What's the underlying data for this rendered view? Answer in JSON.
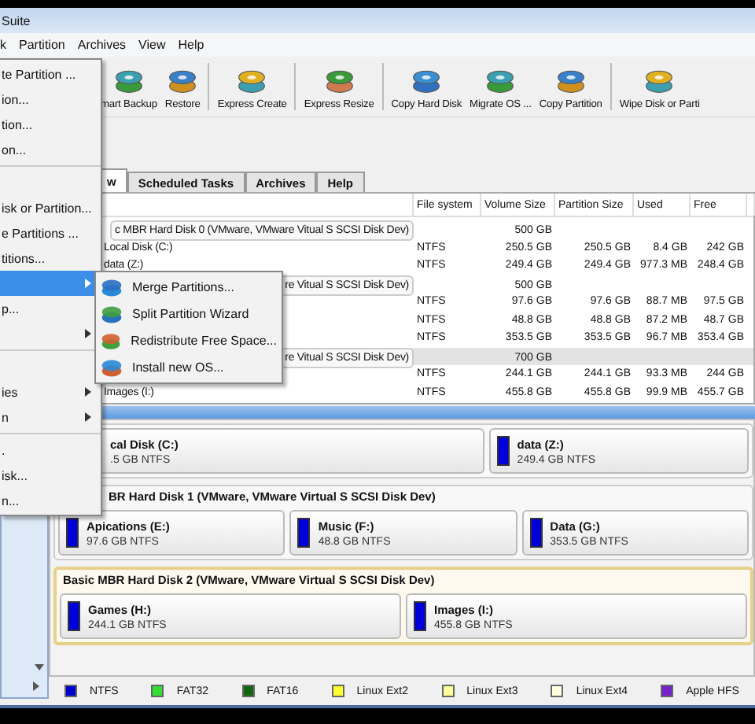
{
  "window": {
    "title": "Suite"
  },
  "menu_bar": [
    "k",
    "Partition",
    "Archives",
    "View",
    "Help"
  ],
  "toolbar": [
    {
      "kind": "button",
      "label": "mart Backup"
    },
    {
      "kind": "button",
      "label": "Restore"
    },
    {
      "kind": "separator"
    },
    {
      "kind": "button",
      "label": "Express Create"
    },
    {
      "kind": "separator"
    },
    {
      "kind": "button",
      "label": "Express Resize"
    },
    {
      "kind": "separator"
    },
    {
      "kind": "button",
      "label": "Copy Hard Disk"
    },
    {
      "kind": "button",
      "label": "Migrate OS ..."
    },
    {
      "kind": "button",
      "label": "Copy Partition"
    },
    {
      "kind": "separator"
    },
    {
      "kind": "button",
      "label": "Wipe Disk or Parti"
    }
  ],
  "tabs": [
    {
      "label": "w",
      "selected": true
    },
    {
      "label": "Scheduled Tasks",
      "selected": false
    },
    {
      "label": "Archives",
      "selected": false
    },
    {
      "label": "Help",
      "selected": false
    }
  ],
  "table": {
    "columns": [
      "File system",
      "Volume Size",
      "Partition Size",
      "Used",
      "Free"
    ],
    "rows": [
      {
        "kind": "disk",
        "name": "c MBR Hard Disk 0 (VMware, VMware Vitual S SCSI Disk Dev)",
        "volume_size": "500 GB",
        "selected": false
      },
      {
        "kind": "partition",
        "name": "Local Disk (C:)",
        "file_system": "NTFS",
        "volume_size": "250.5 GB",
        "partition_size": "250.5 GB",
        "used": "8.4 GB",
        "free": "242 GB"
      },
      {
        "kind": "partition",
        "name": "data (Z:)",
        "file_system": "NTFS",
        "volume_size": "249.4 GB",
        "partition_size": "249.4 GB",
        "used": "977.3 MB",
        "free": "248.4 GB"
      },
      {
        "kind": "disk",
        "name": "re Vitual S SCSI Disk Dev)",
        "volume_size": "500 GB",
        "selected": false
      },
      {
        "kind": "partition",
        "file_system": "NTFS",
        "volume_size": "97.6 GB",
        "partition_size": "97.6 GB",
        "used": "88.7 MB",
        "free": "97.5 GB"
      },
      {
        "kind": "partition",
        "file_system": "NTFS",
        "volume_size": "48.8 GB",
        "partition_size": "48.8 GB",
        "used": "87.2 MB",
        "free": "48.7 GB"
      },
      {
        "kind": "partition",
        "file_system": "NTFS",
        "volume_size": "353.5 GB",
        "partition_size": "353.5 GB",
        "used": "96.7 MB",
        "free": "353.4 GB"
      },
      {
        "kind": "disk",
        "name": "re Vitual S SCSI Disk Dev)",
        "volume_size": "700 GB",
        "selected": true
      },
      {
        "kind": "partition",
        "file_system": "NTFS",
        "volume_size": "244.1 GB",
        "partition_size": "244.1 GB",
        "used": "93.3 MB",
        "free": "244 GB"
      },
      {
        "kind": "partition",
        "name": "Images (I:)",
        "file_system": "NTFS",
        "volume_size": "455.8 GB",
        "partition_size": "455.8 GB",
        "used": "99.9 MB",
        "free": "455.7 GB"
      }
    ]
  },
  "disk_map": {
    "disks": [
      {
        "selected": false,
        "partitions": [
          {
            "label": "cal Disk (C:)",
            "detail": ".5 GB NTFS"
          },
          {
            "label": "data (Z:)",
            "detail": "249.4 GB NTFS",
            "color": "#0000dd"
          }
        ]
      },
      {
        "header": "BR Hard Disk 1 (VMware, VMware Virtual S SCSI Disk Dev)",
        "selected": false,
        "partitions": [
          {
            "label": "Apications (E:)",
            "detail": "97.6 GB NTFS",
            "color": "#0000dd"
          },
          {
            "label": "Music (F:)",
            "detail": "48.8 GB NTFS",
            "color": "#0000dd"
          },
          {
            "label": "Data (G:)",
            "detail": "353.5 GB NTFS",
            "color": "#0000dd"
          }
        ]
      },
      {
        "header": "Basic MBR Hard Disk 2 (VMware, VMware Virtual S SCSI Disk Dev)",
        "selected": true,
        "partitions": [
          {
            "label": "Games (H:)",
            "detail": "244.1 GB NTFS",
            "color": "#0000dd"
          },
          {
            "label": "Images (I:)",
            "detail": "455.8 GB NTFS",
            "color": "#0000dd"
          }
        ]
      }
    ]
  },
  "legend": [
    {
      "label": "NTFS",
      "color": "#0000cc"
    },
    {
      "label": "FAT32",
      "color": "#33dd33"
    },
    {
      "label": "FAT16",
      "color": "#116611"
    },
    {
      "label": "Linux Ext2",
      "color": "#ffff33"
    },
    {
      "label": "Linux Ext3",
      "color": "#ffff99"
    },
    {
      "label": "Linux Ext4",
      "color": "#ffffdd"
    },
    {
      "label": "Apple HFS",
      "color": "#7722cc"
    }
  ],
  "context_menu": [
    {
      "kind": "item",
      "label": "te Partition ...",
      "highlighted": false,
      "submenu": false
    },
    {
      "kind": "item",
      "label": "ion...",
      "highlighted": false,
      "submenu": false
    },
    {
      "kind": "item",
      "label": "tion...",
      "highlighted": false,
      "submenu": false
    },
    {
      "kind": "item",
      "label": "on...",
      "highlighted": false,
      "submenu": false
    },
    {
      "kind": "separator"
    },
    {
      "kind": "blank"
    },
    {
      "kind": "item",
      "label": "isk or Partition...",
      "highlighted": false,
      "submenu": false
    },
    {
      "kind": "item",
      "label": "e Partitions ...",
      "highlighted": false,
      "submenu": false
    },
    {
      "kind": "item",
      "label": "titions...",
      "highlighted": false,
      "submenu": false
    },
    {
      "kind": "item",
      "highlighted": true,
      "submenu": true
    },
    {
      "kind": "item",
      "label": "p...",
      "highlighted": false,
      "submenu": false
    },
    {
      "kind": "item",
      "highlighted": false,
      "submenu": true
    },
    {
      "kind": "separator"
    },
    {
      "kind": "blank"
    },
    {
      "kind": "item",
      "label": "ies",
      "highlighted": false,
      "submenu": true
    },
    {
      "kind": "item",
      "label": "n",
      "highlighted": false,
      "submenu": true
    },
    {
      "kind": "separator"
    },
    {
      "kind": "item",
      "label": ".",
      "highlighted": false,
      "submenu": false
    },
    {
      "kind": "item",
      "label": "isk...",
      "highlighted": false,
      "submenu": false
    },
    {
      "kind": "item",
      "label": "n...",
      "highlighted": false,
      "submenu": false
    }
  ],
  "submenu": [
    "Merge Partitions...",
    "Split Partition Wizard",
    "Redistribute Free Space...",
    "Install new OS..."
  ]
}
